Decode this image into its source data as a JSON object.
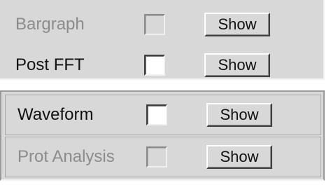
{
  "panels": [
    {
      "rows": [
        {
          "label": "Bargraph",
          "enabled": false,
          "button": "Show"
        },
        {
          "label": "Post FFT",
          "enabled": true,
          "button": "Show"
        }
      ]
    },
    {
      "rows": [
        {
          "label": "Waveform",
          "enabled": true,
          "button": "Show"
        },
        {
          "label": "Prot Analysis",
          "enabled": false,
          "button": "Show"
        }
      ]
    }
  ],
  "colors": {
    "panel_bg": "#d8d8d8",
    "disabled_text": "#8c8c8c",
    "enabled_text": "#111111"
  }
}
